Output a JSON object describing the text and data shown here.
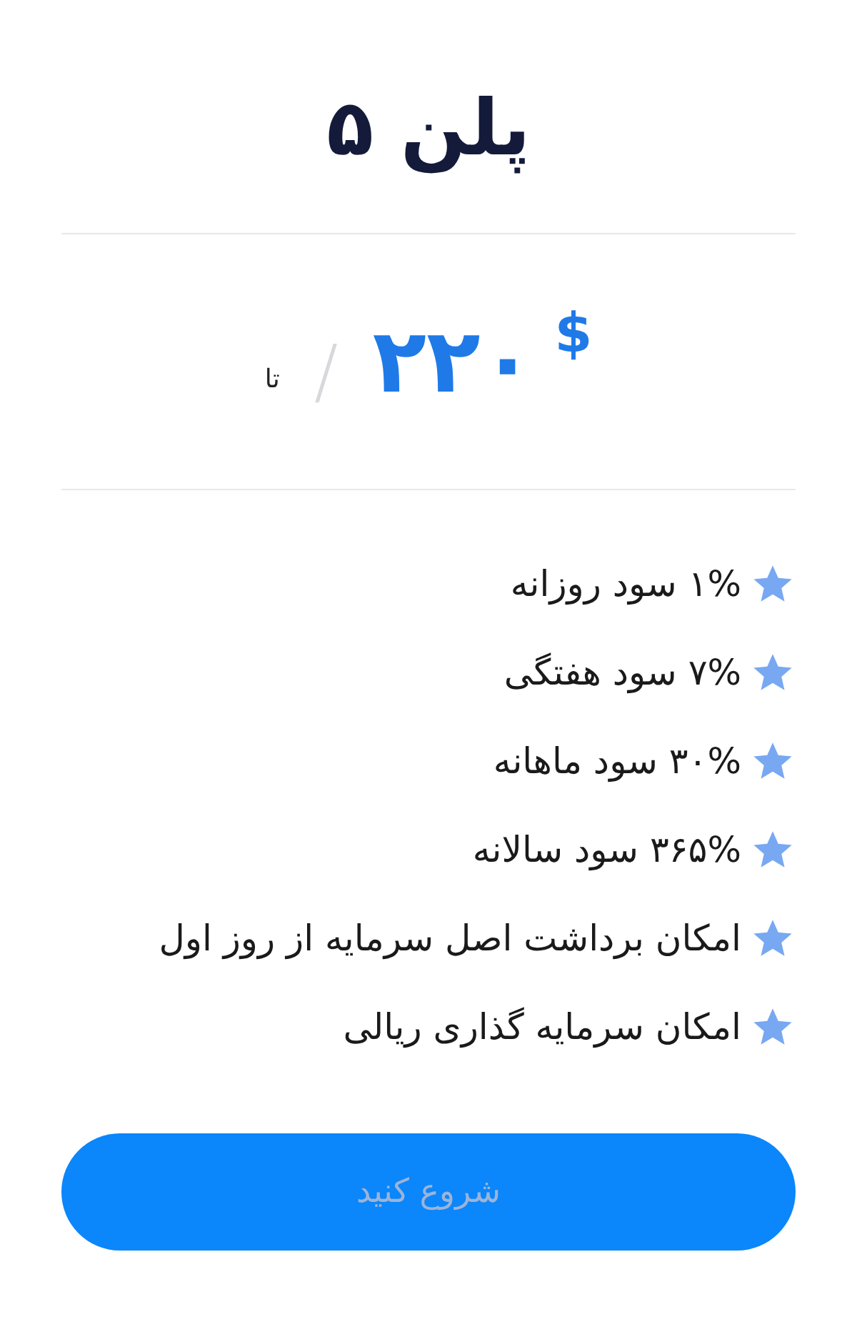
{
  "title": "پلن ۵",
  "price": {
    "currency": "$",
    "amount": "۲۲۰",
    "separator": "/",
    "period": "تا"
  },
  "features": [
    {
      "text": "۱% سود روزانه"
    },
    {
      "text": "۷% سود هفتگی"
    },
    {
      "text": "۳۰% سود ماهانه"
    },
    {
      "text": "۳۶۵% سود سالانه"
    },
    {
      "text": "امکان برداشت اصل سرمایه از روز اول"
    },
    {
      "text": "امکان سرمایه گذاری ریالی"
    }
  ],
  "button": {
    "label": "شروع کنید"
  }
}
